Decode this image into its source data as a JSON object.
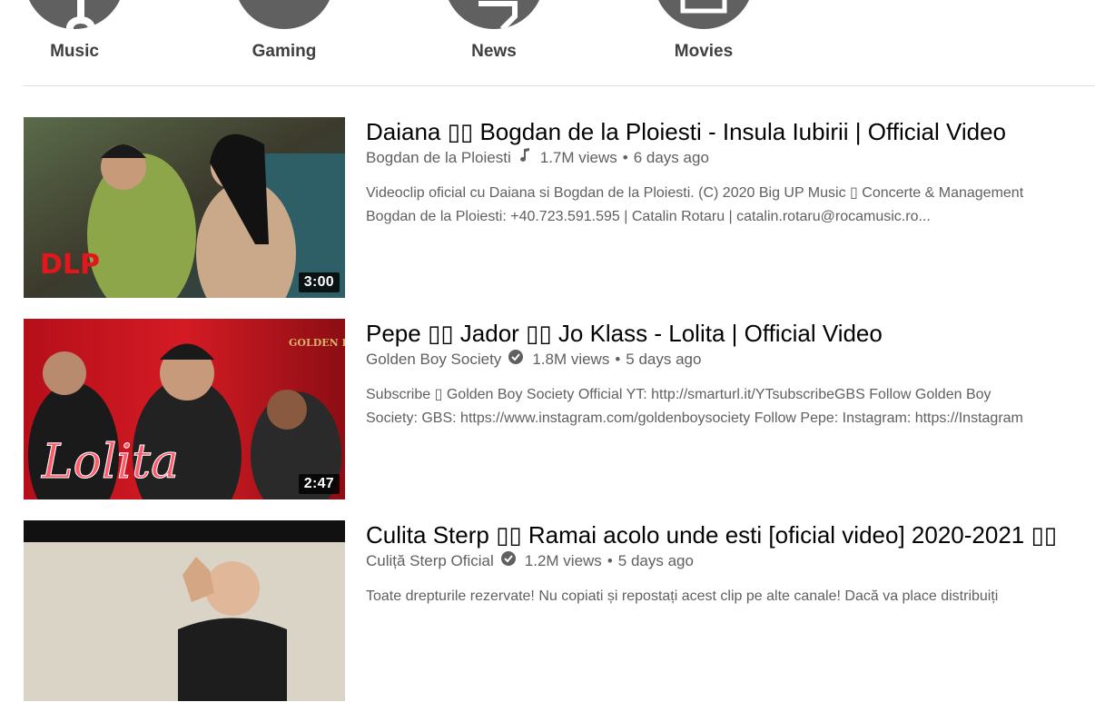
{
  "categories": [
    {
      "label": "Music",
      "icon": "music-note-icon"
    },
    {
      "label": "Gaming",
      "icon": "gamepad-icon"
    },
    {
      "label": "News",
      "icon": "newspaper-icon"
    },
    {
      "label": "Movies",
      "icon": "film-icon"
    }
  ],
  "videos": [
    {
      "title": "Daiana ▯▯ Bogdan de la Ploiesti - Insula Iubirii | Official Video",
      "channel": "Bogdan de la Ploiesti",
      "badge": "music-note-icon",
      "views": "1.7M views",
      "age": "6 days ago",
      "desc_line1": "Videoclip oficial cu Daiana si Bogdan de la Ploiesti. (C) 2020 Big UP Music ▯ Concerte & Management",
      "desc_line2": "Bogdan de la Ploiesti: +40.723.591.595 | Catalin Rotaru | catalin.rotaru@rocamusic.ro...",
      "duration": "3:00",
      "thumb_logo": "DLP"
    },
    {
      "title": "Pepe ▯▯ Jador ▯▯ Jo Klass - Lolita | Official Video",
      "channel": "Golden Boy Society",
      "badge": "verified-check-icon",
      "views": "1.8M views",
      "age": "5 days ago",
      "desc_line1": "Subscribe ▯ Golden Boy Society Official YT: http://smarturl.it/YTsubscribeGBS Follow Golden Boy",
      "desc_line2": "Society: GBS: https://www.instagram.com/goldenboysociety Follow Pepe: Instagram: https://Instagram",
      "duration": "2:47",
      "thumb_logo": "GOLDEN BOY",
      "thumb_script": "Lolita"
    },
    {
      "title": "Culita Sterp ▯▯ Ramai acolo unde esti [oficial video] 2020-2021 ▯▯",
      "channel": "Culiță Sterp Oficial",
      "badge": "verified-check-icon",
      "views": "1.2M views",
      "age": "5 days ago",
      "desc_line1": "Toate drepturile rezervate! Nu copiati și repostați acest clip pe alte canale! Dacă va place distribuiți",
      "desc_line2": "",
      "duration": ""
    }
  ],
  "colors": {
    "text_primary": "#030303",
    "text_secondary": "#606060",
    "category_circle": "#606060",
    "divider": "#e0e0e0"
  }
}
